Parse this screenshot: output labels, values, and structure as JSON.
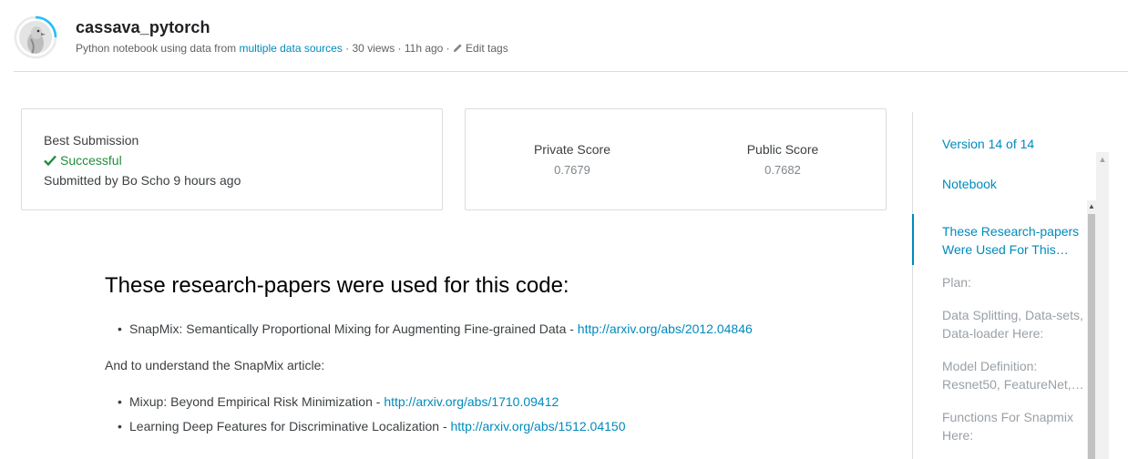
{
  "header": {
    "title": "cassava_pytorch",
    "meta_prefix": "Python notebook using data from ",
    "meta_link": "multiple data sources",
    "meta_views": " · 30 views · 11h ago · ",
    "edit_tags": "Edit tags",
    "progress_ring_color": "#20BEFF"
  },
  "best_submission": {
    "title": "Best Submission",
    "status": "Successful",
    "submitted_by": "Submitted by Bo Scho 9 hours ago"
  },
  "scores": {
    "private_label": "Private Score",
    "private_value": "0.7679",
    "public_label": "Public Score",
    "public_value": "0.7682"
  },
  "content": {
    "heading": "These research-papers were used for this code:",
    "bullets_1": [
      {
        "text": "SnapMix: Semantically Proportional Mixing for Augmenting Fine-grained Data - ",
        "link": "http://arxiv.org/abs/2012.04846"
      }
    ],
    "paragraph": "And to understand the SnapMix article:",
    "bullets_2": [
      {
        "text": "Mixup: Beyond Empirical Risk Minimization - ",
        "link": "http://arxiv.org/abs/1710.09412"
      },
      {
        "text": "Learning Deep Features for Discriminative Localization - ",
        "link": "http://arxiv.org/abs/1512.04150"
      }
    ]
  },
  "sidebar": {
    "version": "Version 14 of 14",
    "notebook": "Notebook",
    "toc": [
      {
        "label": "These Research-papers Were Used For This…",
        "active": true
      },
      {
        "label": "Plan:",
        "active": false
      },
      {
        "label": "Data Splitting, Data-sets, Data-loader Here:",
        "active": false
      },
      {
        "label": "Model Definition: Resnet50, FeatureNet,…",
        "active": false
      },
      {
        "label": "Functions For Snapmix Here:",
        "active": false
      }
    ]
  },
  "colors": {
    "link": "#008ABC",
    "success": "#1E8E3E",
    "muted": "#9AA0A6"
  }
}
